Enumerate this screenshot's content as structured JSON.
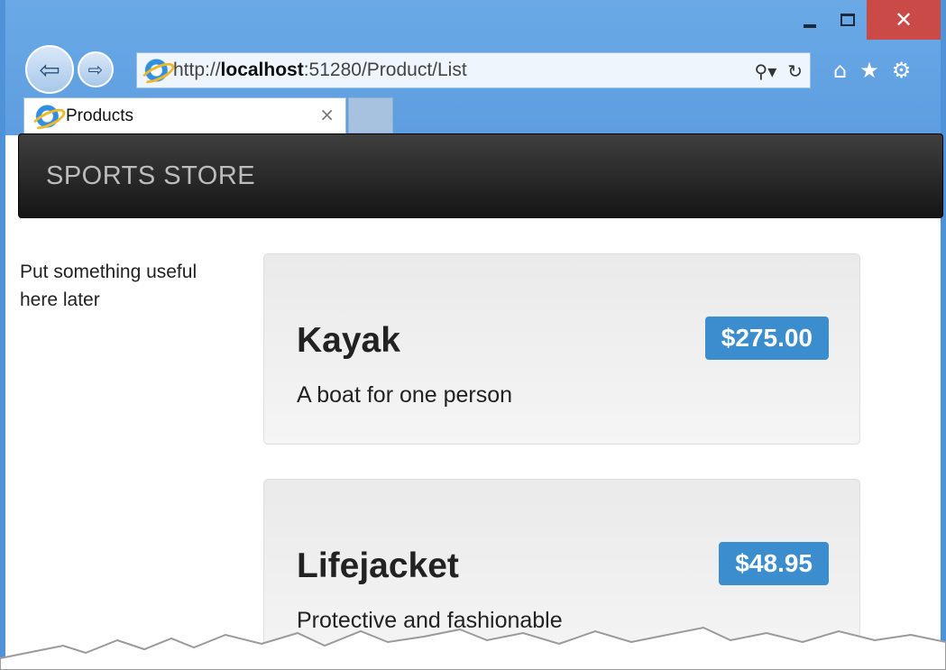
{
  "browser": {
    "address_url_prefix": "http://",
    "address_url_host": "localhost",
    "address_url_rest": ":51280/Product/List",
    "tab_title": "Products",
    "tab_close_glyph": "×",
    "icons": [
      "back-arrow-icon",
      "forward-arrow-icon",
      "ie-icon",
      "search-icon",
      "refresh-icon",
      "home-icon",
      "star-icon",
      "gear-icon",
      "minimize-icon",
      "maximize-icon",
      "close-icon"
    ]
  },
  "navbar": {
    "brand": "SPORTS STORE"
  },
  "sidebar": {
    "text": "Put something useful here later"
  },
  "products": [
    {
      "name": "Kayak",
      "price": "$275.00",
      "description": "A boat for one person"
    },
    {
      "name": "Lifejacket",
      "price": "$48.95",
      "description": "Protective and fashionable"
    }
  ],
  "colors": {
    "chrome_blue": "#5d9ee0",
    "close_red": "#c94a46",
    "navbar_dark": "#222222",
    "price_badge": "#3c8dce"
  }
}
